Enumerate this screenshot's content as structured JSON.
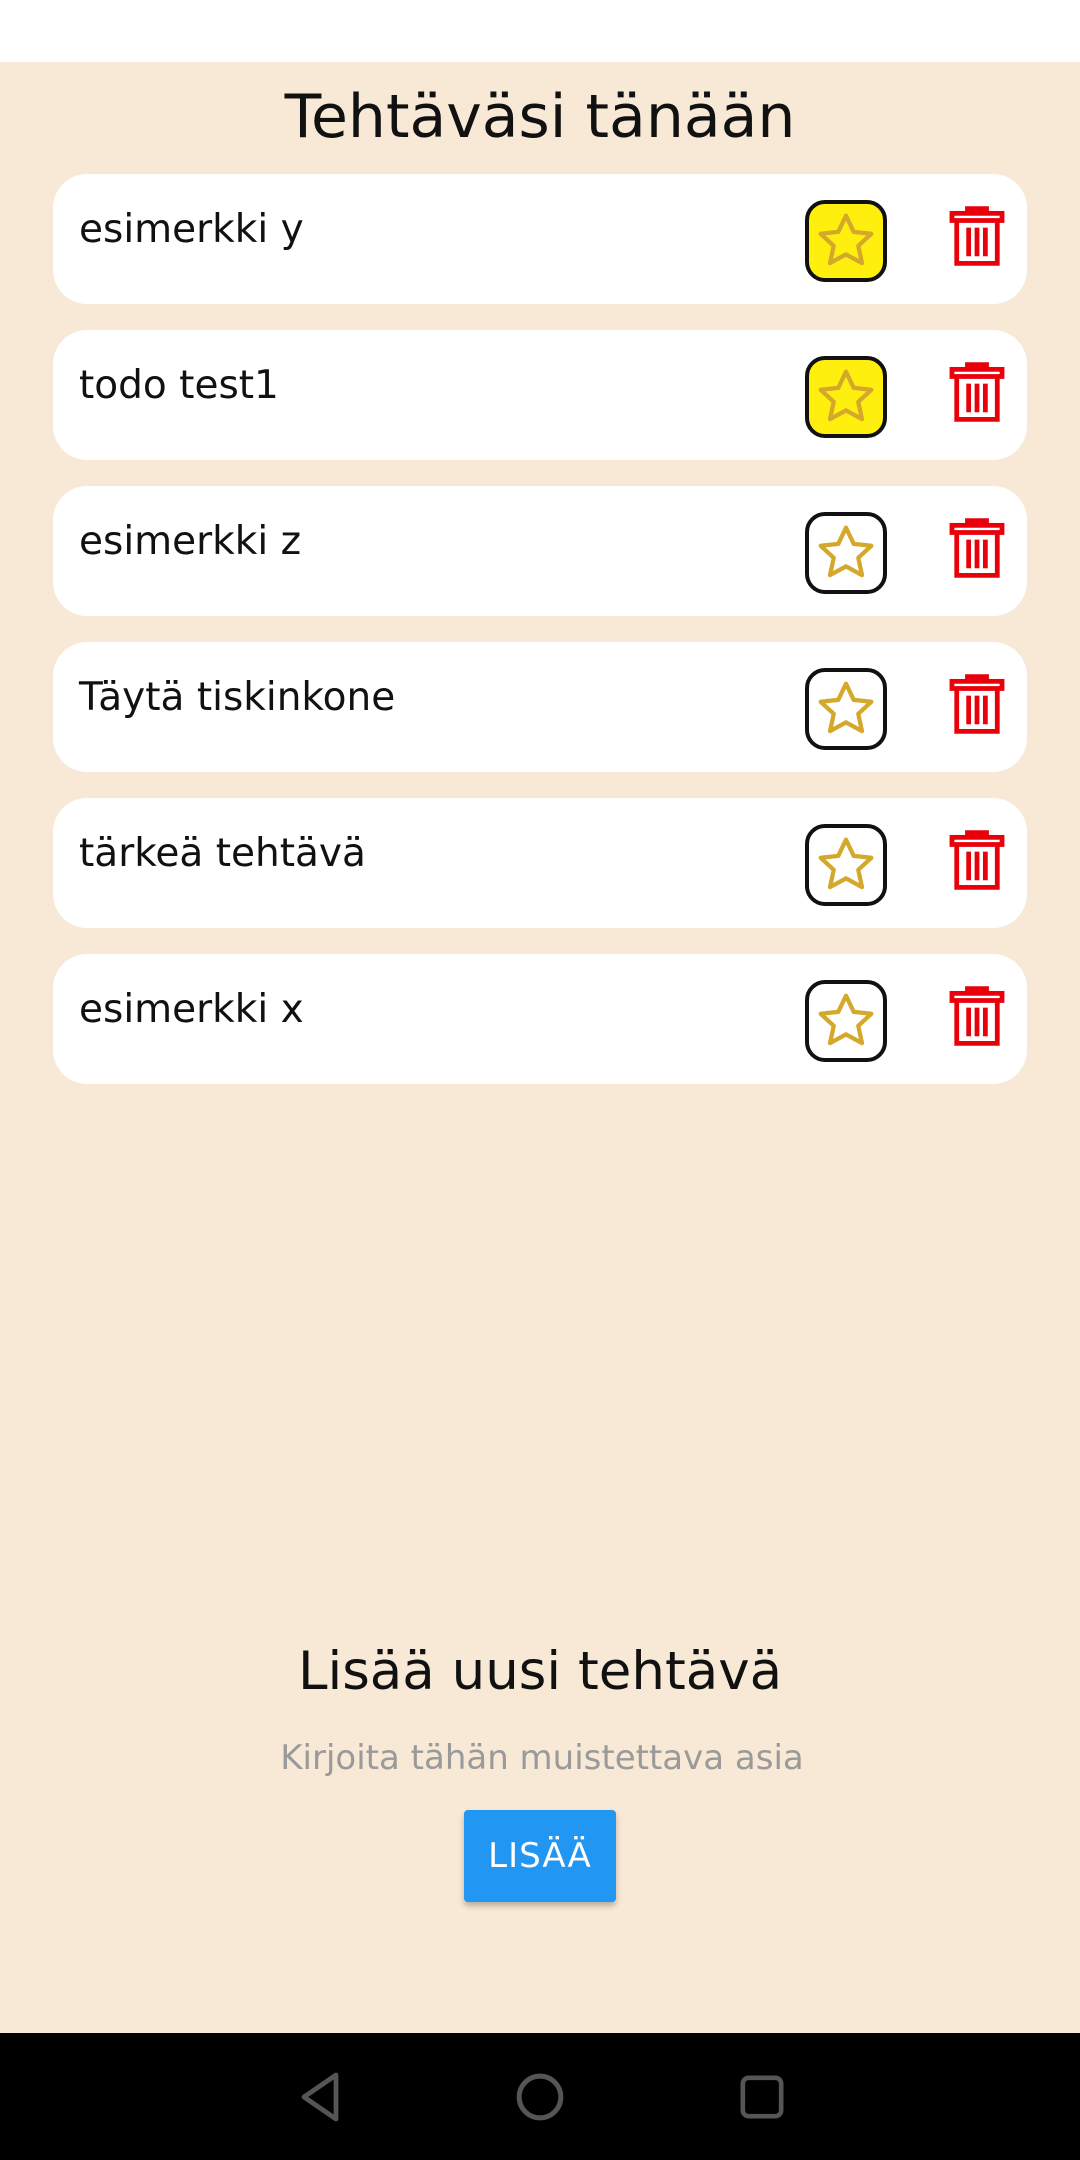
{
  "header": {
    "title": "Tehtäväsi tänään"
  },
  "todos": [
    {
      "text": "esimerkki y",
      "starred": true
    },
    {
      "text": "todo test1",
      "starred": true
    },
    {
      "text": "esimerkki z",
      "starred": false
    },
    {
      "text": "Täytä tiskinkone",
      "starred": false
    },
    {
      "text": "tärkeä tehtävä",
      "starred": false
    },
    {
      "text": "esimerkki x",
      "starred": false
    }
  ],
  "add_section": {
    "title": "Lisää uusi tehtävä",
    "input_placeholder": "Kirjoita tähän muistettava asia",
    "input_value": "",
    "button_label": "LISÄÄ"
  },
  "colors": {
    "background": "#f7e9d6",
    "star_active_fill": "#ffef0e",
    "star_outline": "#d4a82a",
    "trash": "#e8000b",
    "button": "#2196f3"
  },
  "icons": {
    "star": "star-icon",
    "trash": "trash-icon",
    "nav_back": "back-icon",
    "nav_home": "home-icon",
    "nav_recents": "recents-icon"
  }
}
